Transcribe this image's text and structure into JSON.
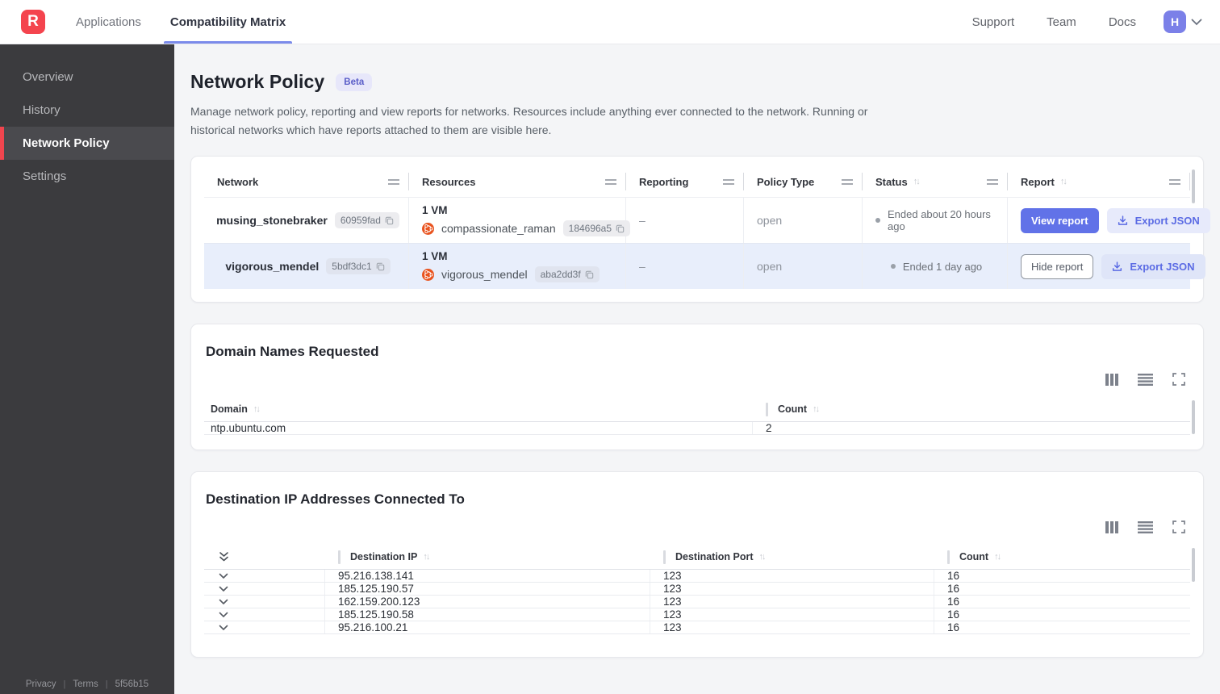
{
  "nav": {
    "logo_letter": "R",
    "tabs": [
      {
        "label": "Applications"
      },
      {
        "label": "Compatibility Matrix"
      }
    ],
    "links": [
      "Support",
      "Team",
      "Docs"
    ],
    "avatar_letter": "H"
  },
  "sidebar": {
    "items": [
      {
        "label": "Overview"
      },
      {
        "label": "History"
      },
      {
        "label": "Network Policy"
      },
      {
        "label": "Settings"
      }
    ],
    "footer": {
      "privacy": "Privacy",
      "terms": "Terms",
      "version": "5f56b15",
      "separator": "|"
    }
  },
  "page": {
    "title": "Network Policy",
    "badge": "Beta",
    "description": "Manage network policy, reporting and view reports for networks. Resources include anything ever connected to the network. Running or historical networks which have reports attached to them are visible here."
  },
  "icons": {
    "sort_up": "↑",
    "sort_down": "↓"
  },
  "network_table": {
    "columns": [
      "Network",
      "Resources",
      "Reporting",
      "Policy Type",
      "Status",
      "Report"
    ],
    "rows": [
      {
        "network_name": "musing_stonebraker",
        "network_id": "60959fad",
        "vm_summary": "1 VM",
        "resource_name": "compassionate_raman",
        "resource_id": "184696a5",
        "reporting": "–",
        "policy_type": "open",
        "status": "Ended about 20 hours ago",
        "report_action": "View report",
        "export_action": "Export JSON"
      },
      {
        "network_name": "vigorous_mendel",
        "network_id": "5bdf3dc1",
        "vm_summary": "1 VM",
        "resource_name": "vigorous_mendel",
        "resource_id": "aba2dd3f",
        "reporting": "–",
        "policy_type": "open",
        "status": "Ended 1 day ago",
        "report_action": "Hide report",
        "export_action": "Export JSON"
      }
    ]
  },
  "domains": {
    "title": "Domain Names Requested",
    "columns": [
      "Domain",
      "Count"
    ],
    "rows": [
      {
        "domain": "ntp.ubuntu.com",
        "count": "2"
      }
    ]
  },
  "destinations": {
    "title": "Destination IP Addresses Connected To",
    "columns": [
      "Destination IP",
      "Destination Port",
      "Count"
    ],
    "rows": [
      {
        "ip": "95.216.138.141",
        "port": "123",
        "count": "16"
      },
      {
        "ip": "185.125.190.57",
        "port": "123",
        "count": "16"
      },
      {
        "ip": "162.159.200.123",
        "port": "123",
        "count": "16"
      },
      {
        "ip": "185.125.190.58",
        "port": "123",
        "count": "16"
      },
      {
        "ip": "95.216.100.21",
        "port": "123",
        "count": "16"
      }
    ]
  },
  "colors": {
    "brand_red": "#F4444E",
    "accent_indigo": "#6172E8",
    "accent_indigo_light": "#E7EAFB",
    "beta_badge_bg": "#E7E7FA",
    "beta_badge_text": "#5A5EC8",
    "row_highlight": "#E8EEFB",
    "sidebar_bg": "#3B3B3E",
    "sidebar_active_bg": "#4A4A4E",
    "ubuntu_orange": "#E95420",
    "status_dot": "#9AA0A8"
  }
}
